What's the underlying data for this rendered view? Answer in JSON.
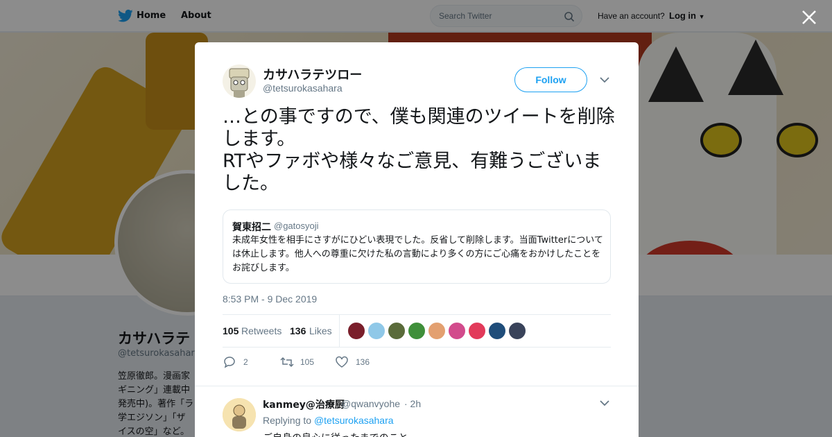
{
  "topnav": {
    "home_label": "Home",
    "about_label": "About",
    "search_placeholder": "Search Twitter",
    "account_question": "Have an account?",
    "login_label": "Log in"
  },
  "profile": {
    "name": "カサハラテ",
    "handle": "@tetsurokasahara",
    "bio": "笠原徹郎。漫画家\nギニング」連載中\n発売中)。著作「ラ\n学エジソン」「ザ\nイスの空」など。"
  },
  "tweet": {
    "author_name": "カサハラテツロー",
    "author_handle": "@tetsurokasahara",
    "follow_label": "Follow",
    "text": "…との事ですので、僕も関連のツイートを削除します。\nRTやファボや様々なご意見、有難うございました。",
    "quote": {
      "name": "賀東招二",
      "handle": "@gatosyoji",
      "text": "未成年女性を相手にさすがにひどい表現でした。反省して削除します。当面Twitterについては休止します。他人への尊重に欠けた私の言動により多くの方にご心痛をおかけしたことをお詫びします。"
    },
    "timestamp": "8:53 PM - 9 Dec 2019",
    "retweets_count": "105",
    "retweets_label": "Retweets",
    "likes_count": "136",
    "likes_label": "Likes",
    "liker_colors": [
      "#7a1f2b",
      "#8fc8e8",
      "#5a6b3a",
      "#3f8f3a",
      "#e3a070",
      "#d24b8c",
      "#e23a5a",
      "#1f4d7a",
      "#39435a"
    ],
    "actions": {
      "reply_count": "2",
      "retweet_count": "105",
      "like_count": "136"
    }
  },
  "reply": {
    "name": "kanmey@治療厨",
    "handle": "@qwanvyohe",
    "time": "· 2h",
    "replying_to_label": "Replying to",
    "replying_to_handle": "@tetsurokasahara",
    "text": "ご自身の良心に従ったまでのこと"
  },
  "colors": {
    "accent": "#1da1f2",
    "text": "#14171a",
    "muted": "#657786"
  }
}
